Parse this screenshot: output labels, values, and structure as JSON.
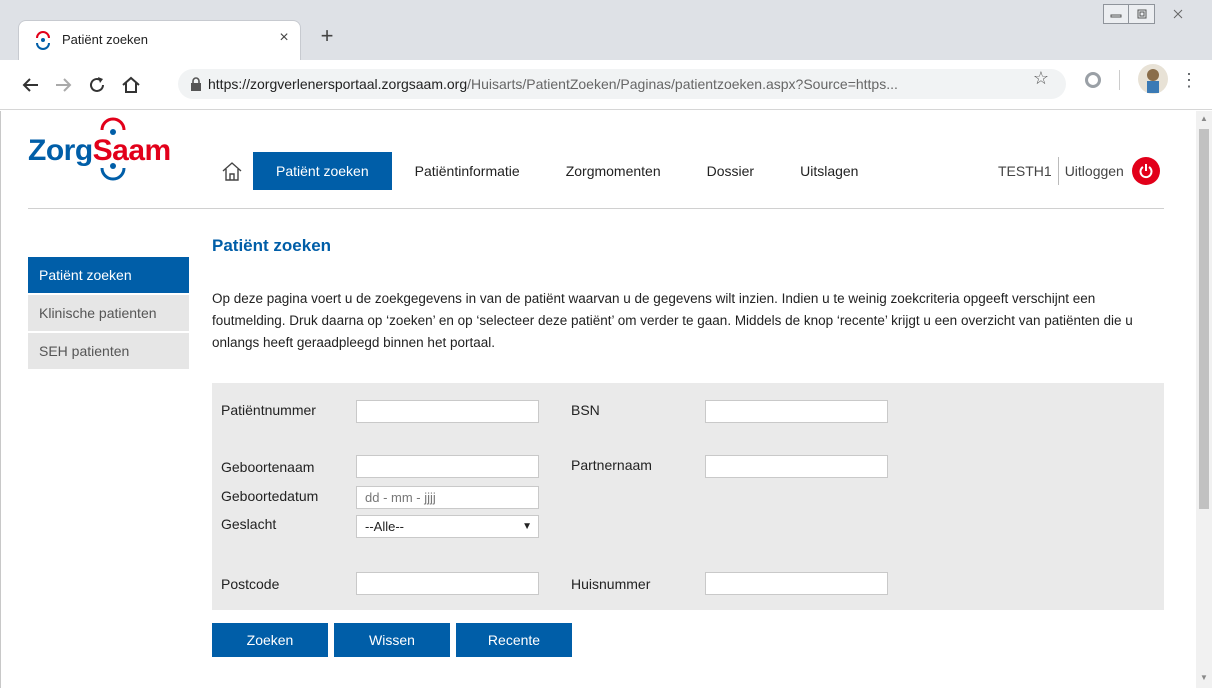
{
  "browser": {
    "tab_title": "Patiënt zoeken",
    "tab_close": "×",
    "new_tab": "+",
    "url_host": "https://zorgverlenersportaal.zorgsaam.org",
    "url_path": "/Huisarts/PatientZoeken/Paginas/patientzoeken.aspx?Source=https..."
  },
  "header": {
    "logo_part1": "Zorg",
    "logo_part2": "Saam",
    "nav": [
      {
        "label": "Patiënt zoeken",
        "active": true
      },
      {
        "label": "Patiëntinformatie"
      },
      {
        "label": "Zorgmomenten"
      },
      {
        "label": "Dossier"
      },
      {
        "label": "Uitslagen"
      }
    ],
    "user": "TESTH1",
    "logout": "Uitloggen"
  },
  "sidebar": {
    "items": [
      {
        "label": "Patiënt zoeken",
        "active": true
      },
      {
        "label": "Klinische patienten"
      },
      {
        "label": "SEH patienten"
      }
    ]
  },
  "main": {
    "title": "Patiënt zoeken",
    "intro": "Op deze pagina voert u de zoekgegevens in van de patiënt waarvan u de gegevens wilt inzien. Indien u te weinig zoekcriteria opgeeft verschijnt een foutmelding. Druk daarna op ‘zoeken’ en op ‘selecteer deze patiënt’ om verder te gaan. Middels de knop ‘recente’ krijgt u een overzicht van patiënten die u onlangs heeft geraadpleegd binnen het portaal."
  },
  "form": {
    "patientnummer_label": "Patiëntnummer",
    "bsn_label": "BSN",
    "geboortenaam_label": "Geboortenaam",
    "partnernaam_label": "Partnernaam",
    "geboortedatum_label": "Geboortedatum",
    "geboortedatum_placeholder": "dd  - mm -  jjjj",
    "geslacht_label": "Geslacht",
    "geslacht_value": "--Alle--",
    "postcode_label": "Postcode",
    "huisnummer_label": "Huisnummer"
  },
  "buttons": {
    "zoeken": "Zoeken",
    "wissen": "Wissen",
    "recente": "Recente"
  },
  "colors": {
    "brand_blue": "#005ea8",
    "brand_red": "#e2001a"
  }
}
